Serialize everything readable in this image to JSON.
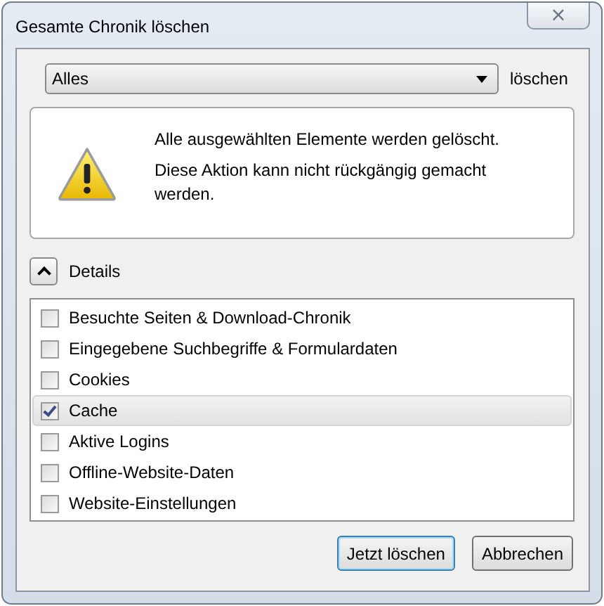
{
  "window": {
    "title": "Gesamte Chronik löschen",
    "close": "×"
  },
  "range": {
    "value": "Alles",
    "label": "löschen"
  },
  "warning": {
    "lines": [
      "Alle ausgewählten Elemente werden gelöscht.",
      "Diese Aktion kann nicht rückgängig gemacht werden."
    ]
  },
  "details": {
    "label": "Details",
    "expanded": true
  },
  "items": [
    {
      "label": "Besuchte Seiten & Download-Chronik",
      "checked": false,
      "selected": false
    },
    {
      "label": "Eingegebene Suchbegriffe & Formulardaten",
      "checked": false,
      "selected": false
    },
    {
      "label": "Cookies",
      "checked": false,
      "selected": false
    },
    {
      "label": "Cache",
      "checked": true,
      "selected": true
    },
    {
      "label": "Aktive Logins",
      "checked": false,
      "selected": false
    },
    {
      "label": "Offline-Website-Daten",
      "checked": false,
      "selected": false
    },
    {
      "label": "Website-Einstellungen",
      "checked": false,
      "selected": false
    }
  ],
  "buttons": [
    {
      "label": "Jetzt löschen",
      "default": true
    },
    {
      "label": "Abbrechen",
      "default": false
    }
  ]
}
